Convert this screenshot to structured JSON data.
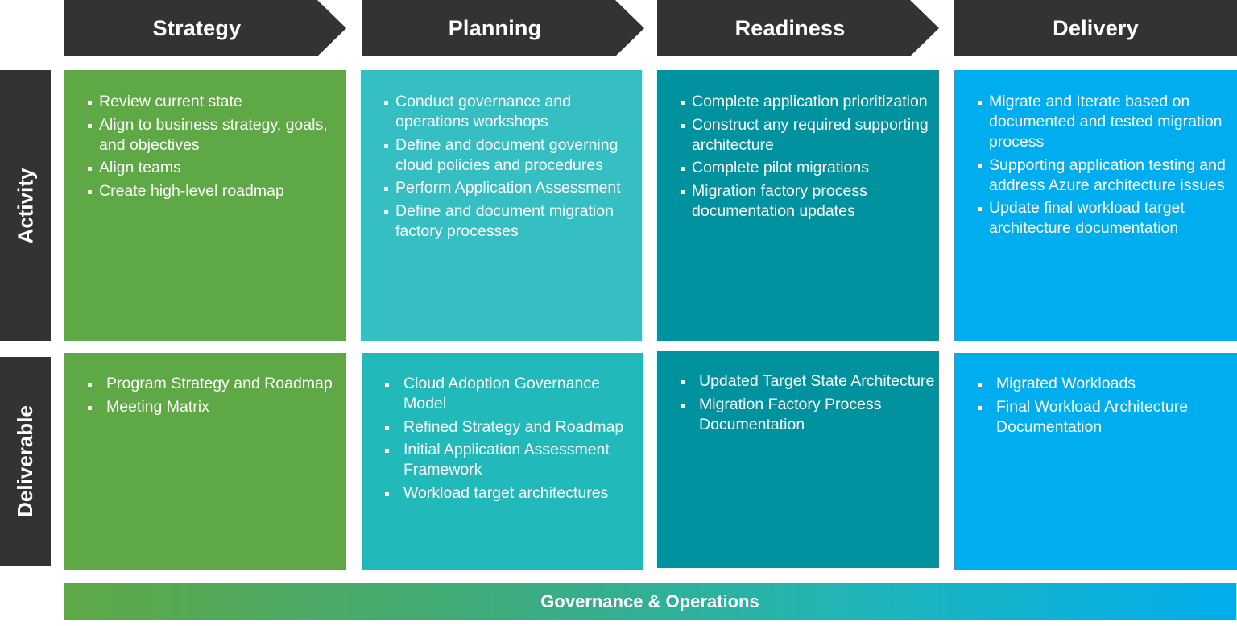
{
  "phases": [
    {
      "label": "Strategy",
      "color": "#5fa846"
    },
    {
      "label": "Planning",
      "color": "#35bfc2"
    },
    {
      "label": "Readiness",
      "color": "#00929e"
    },
    {
      "label": "Delivery",
      "color": "#00adee"
    }
  ],
  "rows": {
    "activity": "Activity",
    "deliverable": "Deliverable"
  },
  "activities": [
    [
      "Review current state",
      "Align to business strategy, goals, and objectives",
      "Align teams",
      "Create high-level roadmap"
    ],
    [
      "Conduct governance and operations workshops",
      "Define and document governing cloud policies and procedures",
      "Perform Application Assessment",
      "Define and document migration factory processes"
    ],
    [
      "Complete application prioritization",
      "Construct any required supporting architecture",
      "Complete pilot migrations",
      "Migration factory process documentation updates"
    ],
    [
      "Migrate and Iterate based on documented and tested migration process",
      "Supporting application testing and address Azure architecture issues",
      "Update final workload target architecture documentation"
    ]
  ],
  "deliverables": [
    [
      "Program Strategy and Roadmap",
      "Meeting Matrix"
    ],
    [
      "Cloud Adoption Governance Model",
      "Refined Strategy and Roadmap",
      "Initial Application Assessment Framework",
      "Workload target architectures"
    ],
    [
      "Updated Target State Architecture",
      "Migration Factory Process Documentation"
    ],
    [
      "Migrated Workloads",
      "Final Workload Architecture Documentation"
    ]
  ],
  "footer": {
    "label": "Governance & Operations"
  }
}
